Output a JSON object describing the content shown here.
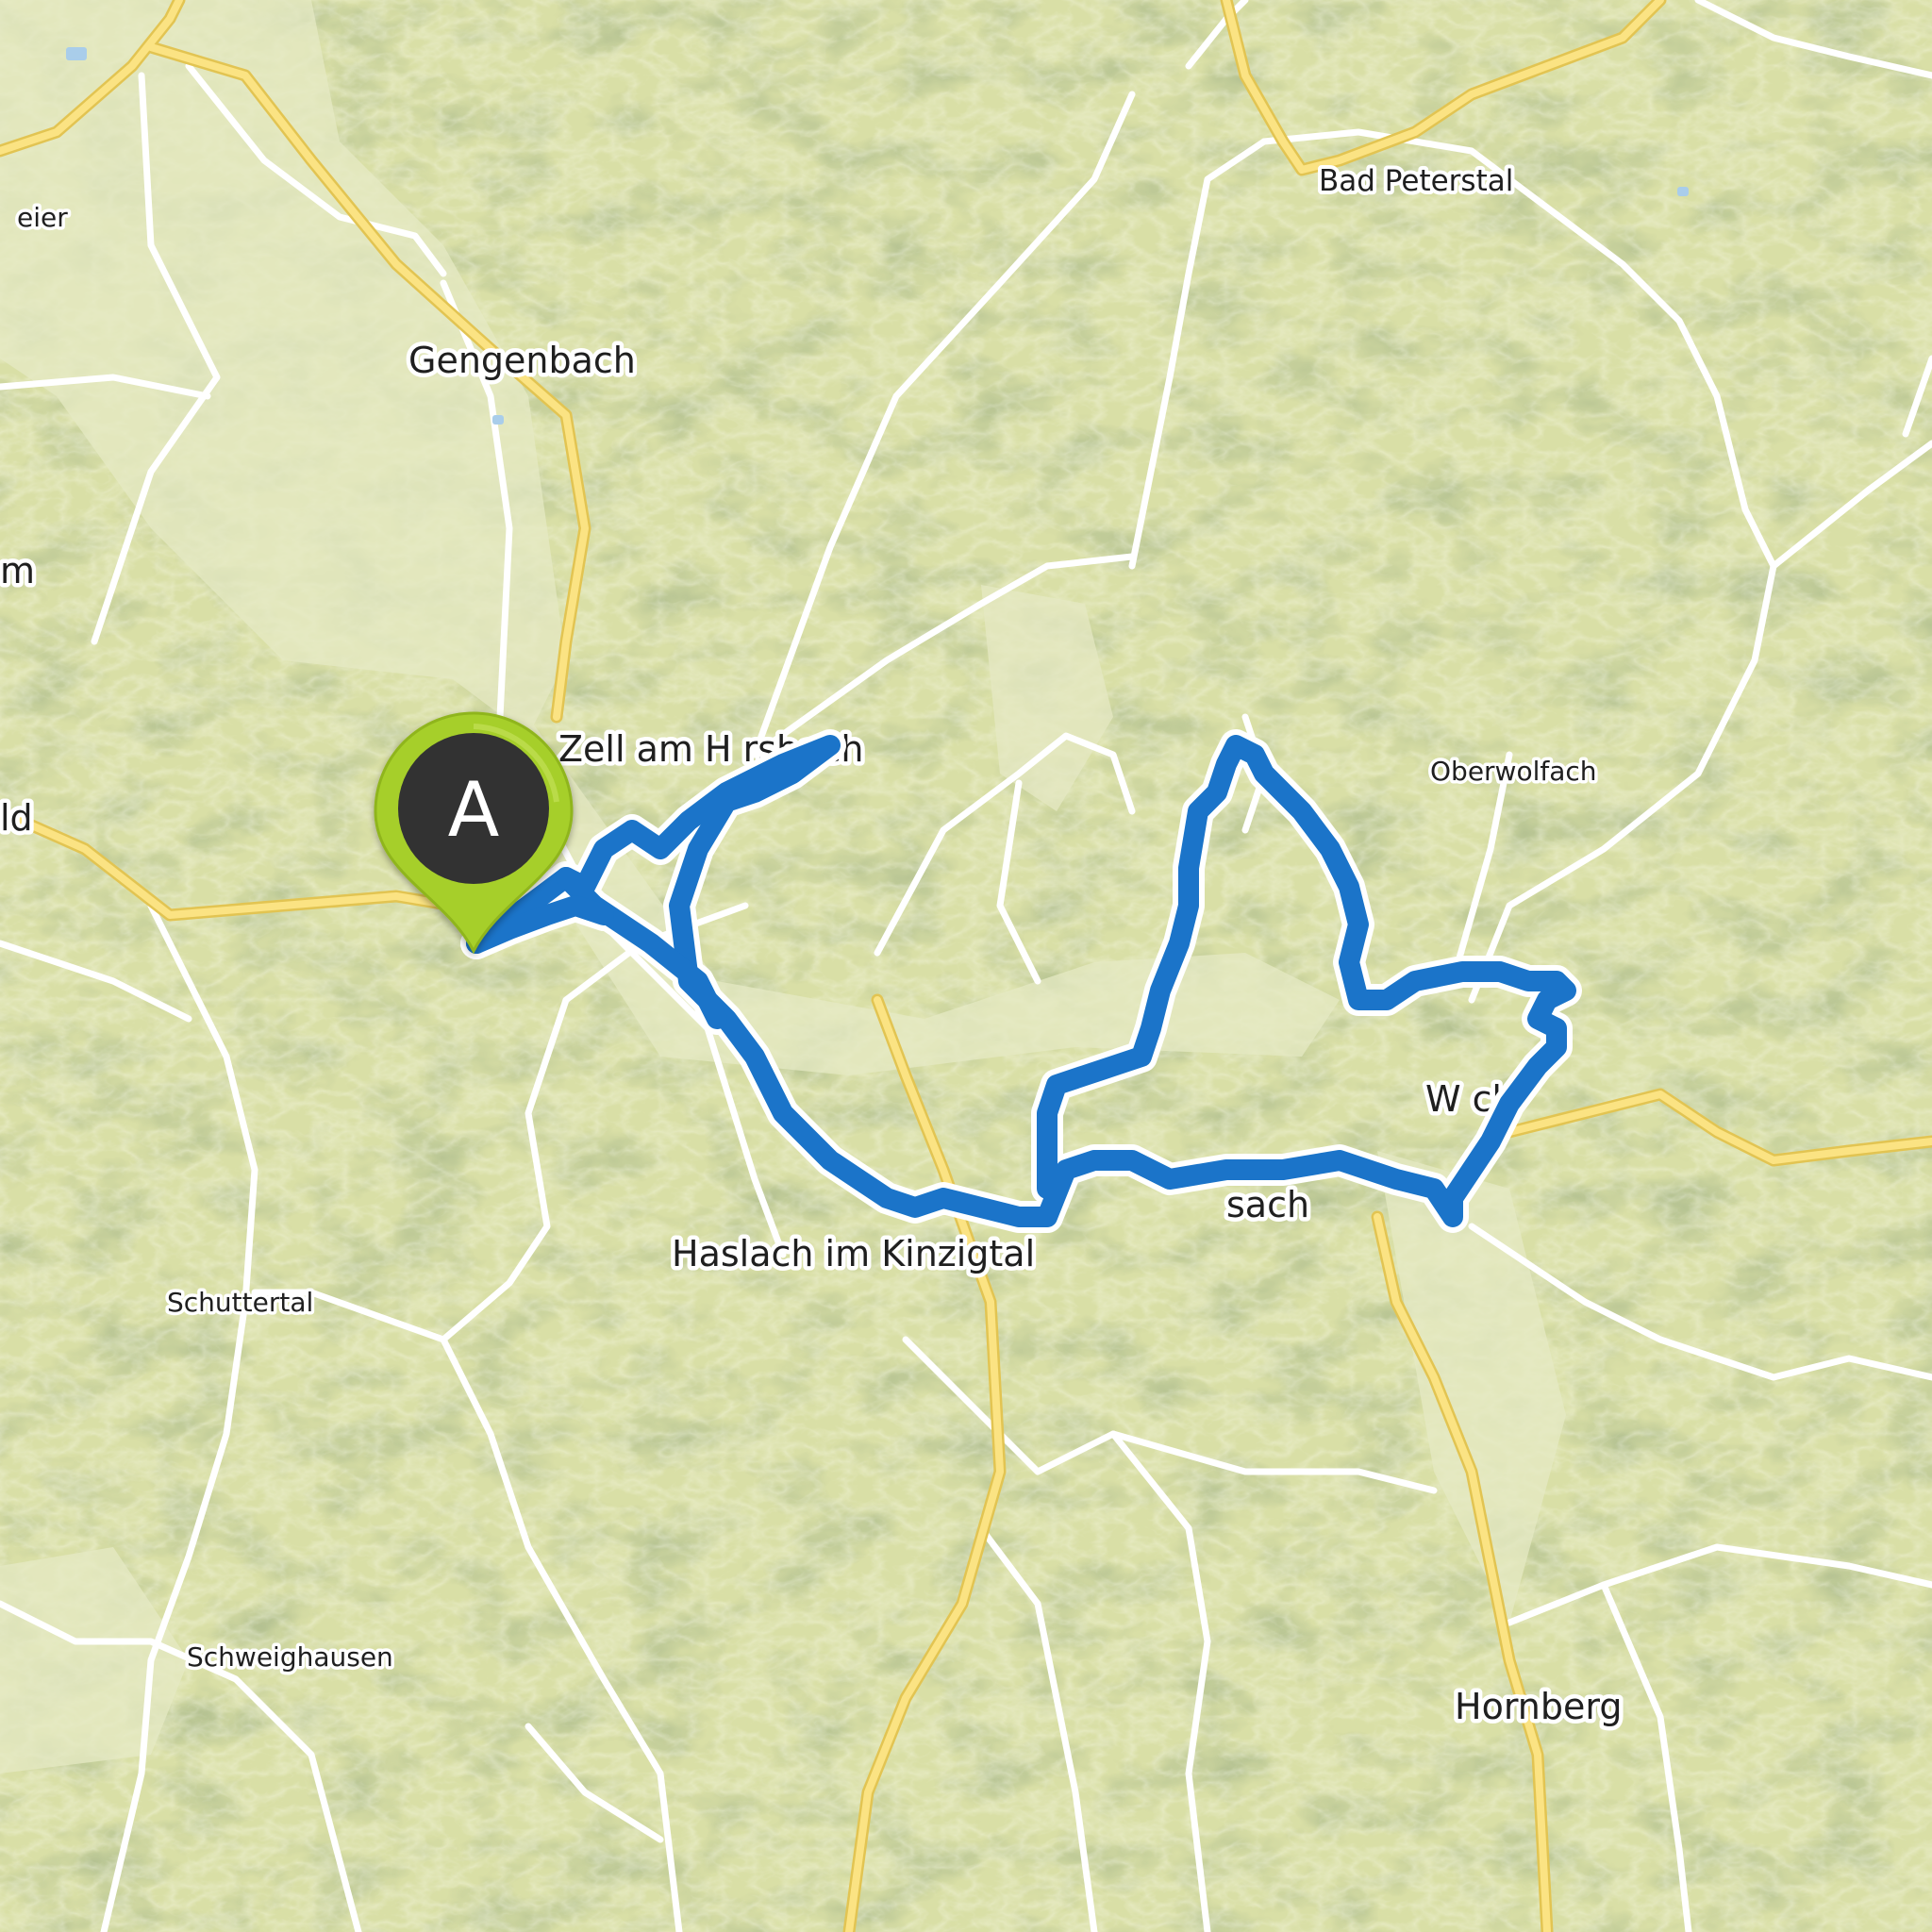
{
  "map": {
    "style": "terrain",
    "colors": {
      "land": "#d9dfa6",
      "hills": "#bfc98a",
      "forest_shade": "#a9b877",
      "road_major": "#fbe383",
      "road_major_casing": "#e8c85a",
      "road_minor": "#ffffff",
      "route": "#1b74c9",
      "route_casing": "#ffffff",
      "marker": "#a6cf2a",
      "marker_inner": "#333333"
    },
    "places": [
      {
        "id": "bad-peterstal",
        "label": "Bad Peterstal"
      },
      {
        "id": "gengenbach",
        "label": "Gengenbach"
      },
      {
        "id": "zell",
        "label": "Zell am H     rsbach"
      },
      {
        "id": "oberwolfach",
        "label": "Oberwolfach"
      },
      {
        "id": "wolfach",
        "label": "W      ch"
      },
      {
        "id": "hausach",
        "label": "    sach"
      },
      {
        "id": "haslach",
        "label": "Haslach im Kinzigtal"
      },
      {
        "id": "schuttertal",
        "label": "Schuttertal"
      },
      {
        "id": "schweighausen",
        "label": "Schweighausen"
      },
      {
        "id": "hornberg",
        "label": "Hornberg"
      },
      {
        "id": "edge-weier",
        "label": "eier"
      },
      {
        "id": "edge-m",
        "label": "m"
      },
      {
        "id": "edge-ld",
        "label": "ld"
      }
    ],
    "route": {
      "start_marker_label": "A",
      "marker_icon": "map-pin-icon"
    }
  }
}
